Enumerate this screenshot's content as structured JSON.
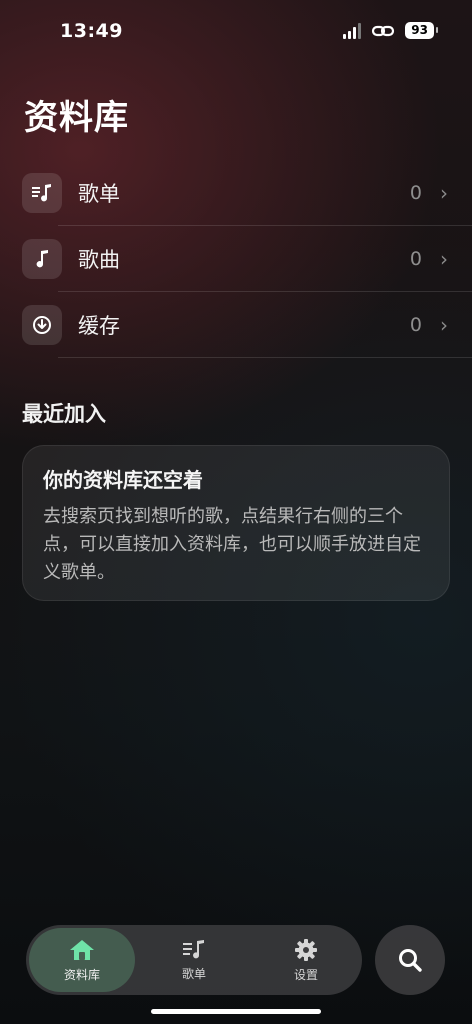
{
  "status_bar": {
    "time": "13:49",
    "battery": "93",
    "icons": [
      "signal-icon",
      "link-icon",
      "battery-icon"
    ]
  },
  "page": {
    "title": "资料库"
  },
  "menu": {
    "items": [
      {
        "label": "歌单",
        "count": "0",
        "icon": "playlist-icon"
      },
      {
        "label": "歌曲",
        "count": "0",
        "icon": "music-note-icon"
      },
      {
        "label": "缓存",
        "count": "0",
        "icon": "download-icon"
      }
    ]
  },
  "recent": {
    "section_title": "最近加入",
    "empty_title": "你的资料库还空着",
    "empty_desc": "去搜索页找到想听的歌，点结果行右侧的三个点，可以直接加入资料库，也可以顺手放进自定义歌单。"
  },
  "tab_bar": {
    "tabs": [
      {
        "label": "资料库",
        "icon": "home-icon",
        "active": true
      },
      {
        "label": "歌单",
        "icon": "playlist-icon",
        "active": false
      },
      {
        "label": "设置",
        "icon": "gear-icon",
        "active": false
      }
    ],
    "accent": "#6fe3a8"
  },
  "search_button": {
    "icon": "search-icon"
  }
}
